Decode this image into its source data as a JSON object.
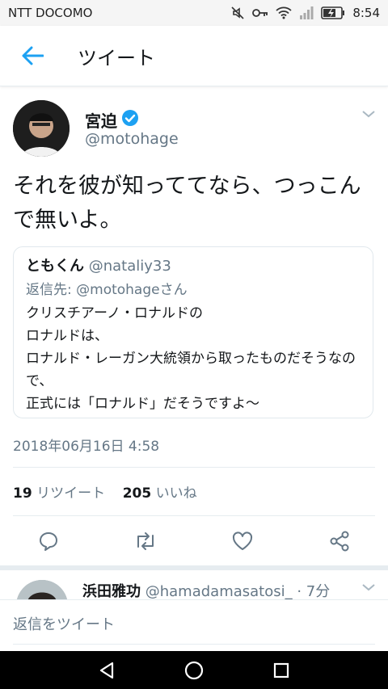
{
  "status_bar": {
    "carrier": "NTT DOCOMO",
    "time": "8:54"
  },
  "header": {
    "title": "ツイート"
  },
  "tweet": {
    "author_name": "宮迫",
    "author_handle": "@motohage",
    "text": "それを彼が知っててなら、つっこんで無いよ。",
    "timestamp": "2018年06月16日 4:58",
    "retweet_count": "19",
    "retweet_label": "リツイート",
    "like_count": "205",
    "like_label": "いいね"
  },
  "quoted_tweet": {
    "author_name": "ともくん",
    "author_handle": "@nataliy33",
    "reply_to": "返信先: @motohageさん",
    "lines": [
      "クリスチアーノ・ロナルドの",
      "ロナルドは、",
      "ロナルド・レーガン大統領から取ったものだそうなので、",
      "正式には「ロナルド」だそうですよ〜"
    ]
  },
  "reply_preview": {
    "author_name": "浜田雅功",
    "author_handle": "@hamadamasatosi_",
    "time_ago": "· 7分"
  },
  "compose": {
    "placeholder": "返信をツイート"
  },
  "colors": {
    "accent": "#1da1f2",
    "secondary_text": "#657786",
    "divider": "#e6ecf0"
  }
}
